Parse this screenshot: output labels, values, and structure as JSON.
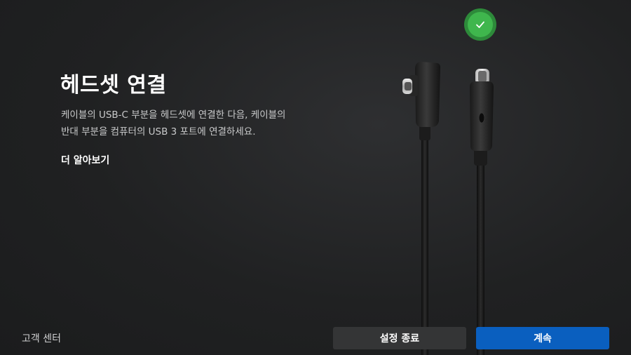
{
  "page": {
    "title": "헤드셋 연결",
    "description_lines": [
      "케이블의 USB-C 부분을 헤드셋에 연결한 다음, 케이블의",
      "반대 부분을 컴퓨터의 USB 3 포트에 연결하세요."
    ],
    "learn_more_label": "더 알아보기"
  },
  "footer": {
    "support_label": "고객 센터",
    "exit_setup_label": "설정 종료",
    "continue_label": "계속"
  },
  "status": {
    "connection": "connected",
    "icon": "check-icon",
    "color": "#3fb64d"
  },
  "colors": {
    "background": "#202122",
    "primary_button": "#0a5fbf",
    "secondary_button": "#343536"
  }
}
